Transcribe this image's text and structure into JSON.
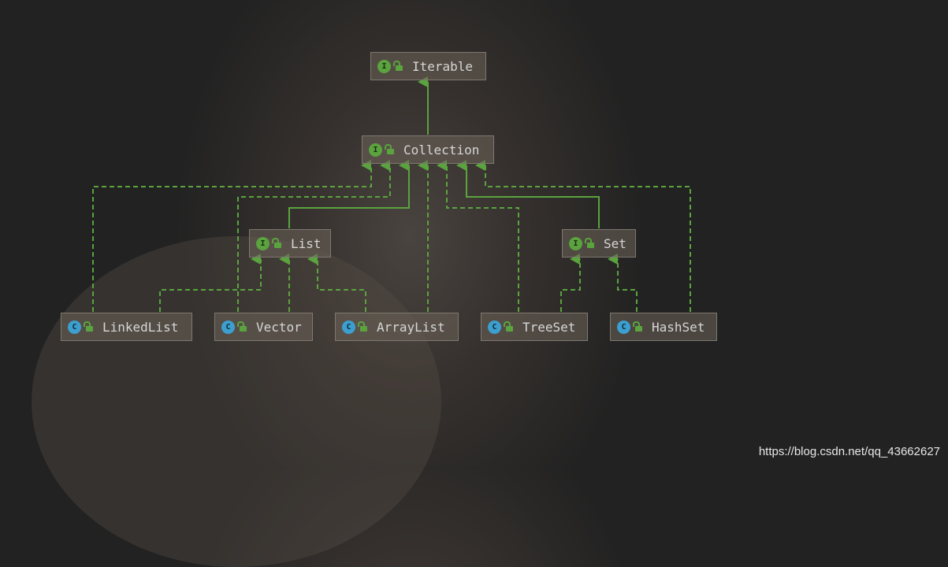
{
  "diagram": {
    "nodes": {
      "iterable": {
        "label": "Iterable",
        "kind": "interface",
        "badge": "I"
      },
      "collection": {
        "label": "Collection",
        "kind": "interface",
        "badge": "I"
      },
      "list": {
        "label": "List",
        "kind": "interface",
        "badge": "I"
      },
      "set": {
        "label": "Set",
        "kind": "interface",
        "badge": "I"
      },
      "linkedlist": {
        "label": "LinkedList",
        "kind": "class",
        "badge": "C"
      },
      "vector": {
        "label": "Vector",
        "kind": "class",
        "badge": "C"
      },
      "arraylist": {
        "label": "ArrayList",
        "kind": "class",
        "badge": "C"
      },
      "treeset": {
        "label": "TreeSet",
        "kind": "class",
        "badge": "C"
      },
      "hashset": {
        "label": "HashSet",
        "kind": "class",
        "badge": "C"
      }
    },
    "edges": [
      {
        "from": "Collection",
        "to": "Iterable",
        "type": "extends"
      },
      {
        "from": "List",
        "to": "Collection",
        "type": "extends"
      },
      {
        "from": "Set",
        "to": "Collection",
        "type": "extends"
      },
      {
        "from": "LinkedList",
        "to": "Collection",
        "type": "implements"
      },
      {
        "from": "Vector",
        "to": "Collection",
        "type": "implements"
      },
      {
        "from": "ArrayList",
        "to": "Collection",
        "type": "implements"
      },
      {
        "from": "TreeSet",
        "to": "Collection",
        "type": "implements"
      },
      {
        "from": "HashSet",
        "to": "Collection",
        "type": "implements"
      },
      {
        "from": "LinkedList",
        "to": "List",
        "type": "implements"
      },
      {
        "from": "Vector",
        "to": "List",
        "type": "implements"
      },
      {
        "from": "ArrayList",
        "to": "List",
        "type": "implements"
      },
      {
        "from": "TreeSet",
        "to": "Set",
        "type": "implements"
      },
      {
        "from": "HashSet",
        "to": "Set",
        "type": "implements"
      }
    ],
    "colors": {
      "edge": "#5aa33e",
      "interface_badge": "#5aa33e",
      "class_badge": "#3d9fcf"
    }
  },
  "watermark": "https://blog.csdn.net/qq_43662627"
}
